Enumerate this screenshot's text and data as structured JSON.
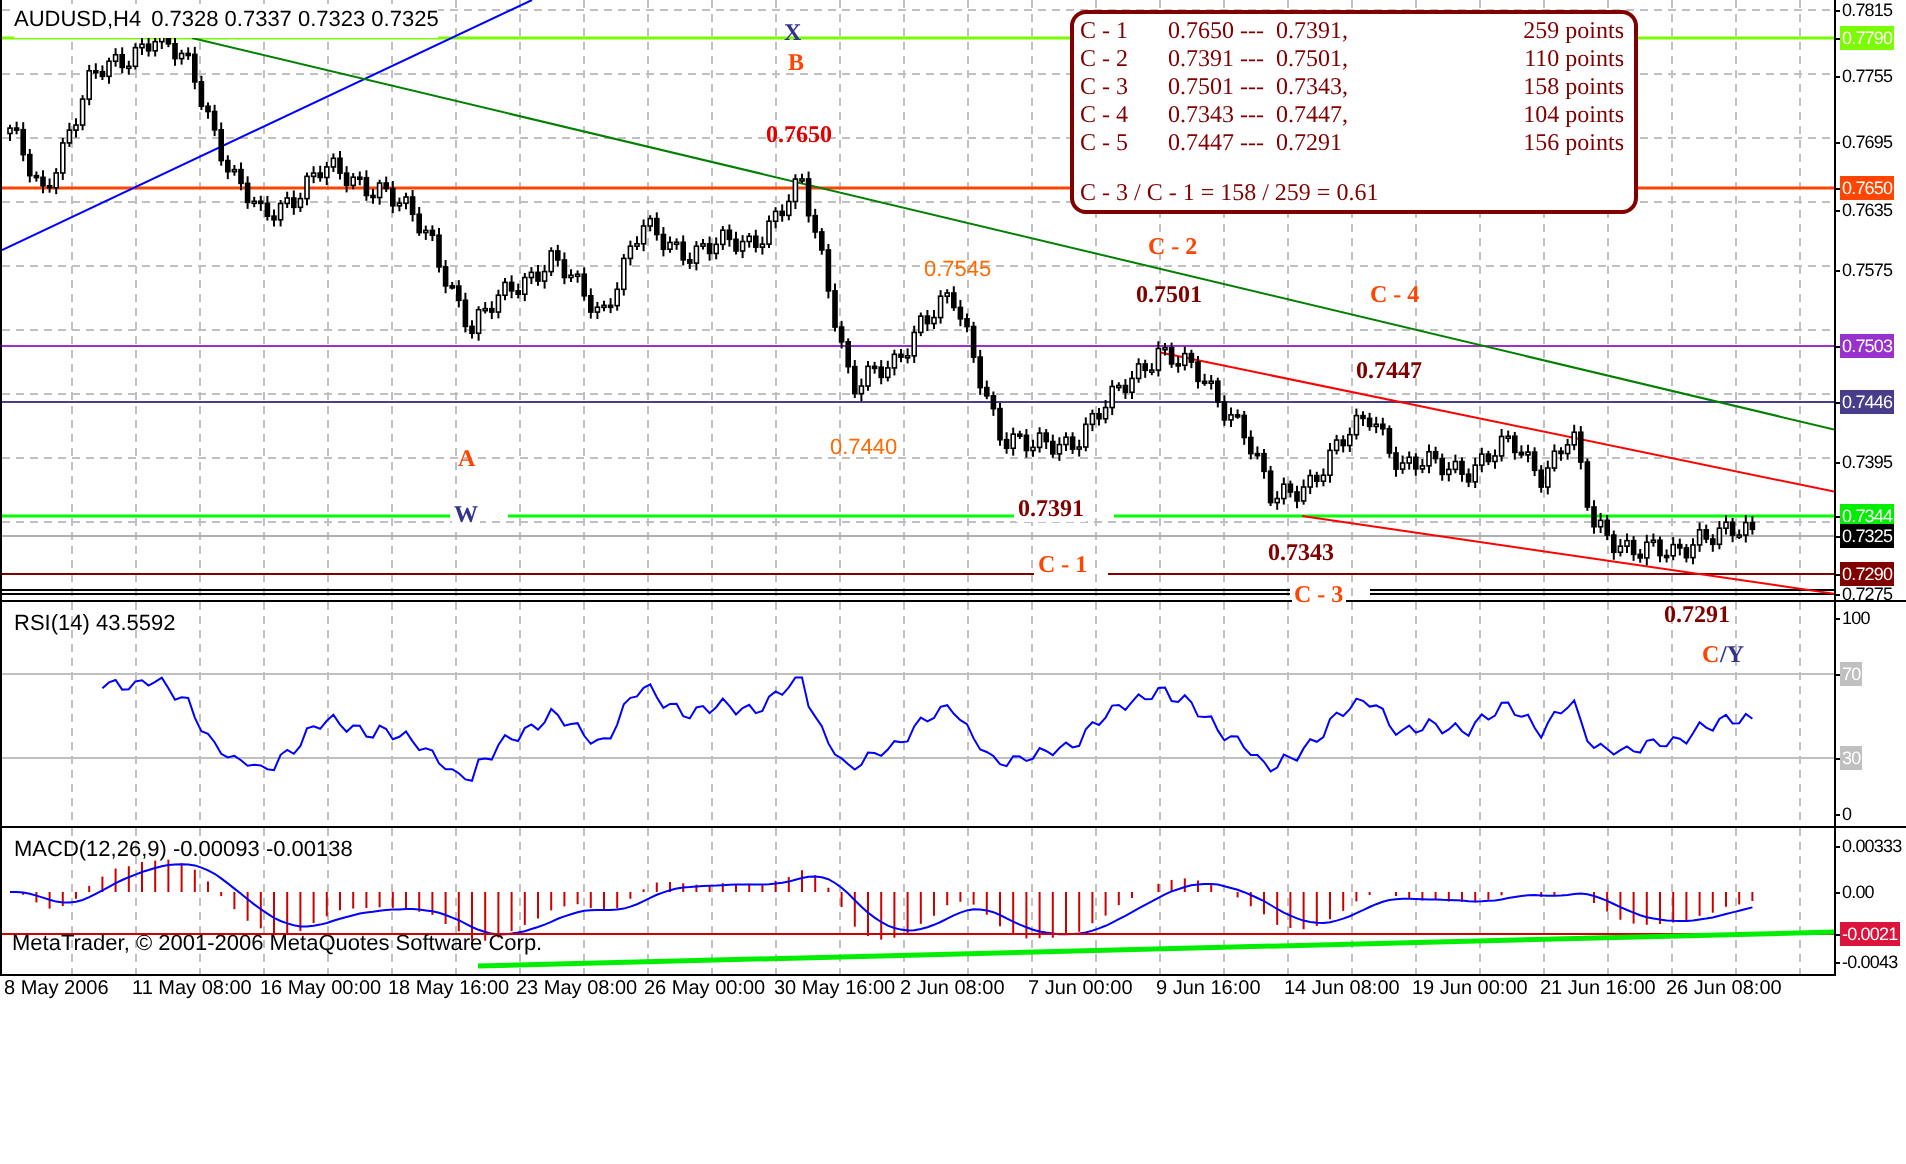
{
  "chart": {
    "symbol": "AUDUSD,H4",
    "ohlc": "0.7328 0.7337 0.7323 0.7325",
    "annotations": [
      {
        "text": "X",
        "kind": "wave",
        "color": "#33338b"
      },
      {
        "text": "B",
        "kind": "wave",
        "color": "#ff4500"
      },
      {
        "text": "0.7650",
        "kind": "wave",
        "color": "#e00000"
      },
      {
        "text": "0.7545",
        "kind": "level",
        "color": "#ff6a00"
      },
      {
        "text": "C - 2",
        "kind": "wave",
        "color": "#ff4500"
      },
      {
        "text": "0.7501",
        "kind": "wave",
        "color": "#800000"
      },
      {
        "text": "C - 4",
        "kind": "wave",
        "color": "#ff4500"
      },
      {
        "text": "0.7447",
        "kind": "wave",
        "color": "#800000"
      },
      {
        "text": "A",
        "kind": "wave",
        "color": "#ff4500"
      },
      {
        "text": "0.7440",
        "kind": "level",
        "color": "#ff6a00"
      },
      {
        "text": "W",
        "kind": "wave",
        "color": "#33338b"
      },
      {
        "text": "0.7391",
        "kind": "wave",
        "color": "#800000"
      },
      {
        "text": "C - 1",
        "kind": "wave",
        "color": "#ff4500"
      },
      {
        "text": "0.7343",
        "kind": "wave",
        "color": "#800000"
      },
      {
        "text": "C - 3",
        "kind": "wave",
        "color": "#ff4500"
      },
      {
        "text": "0.7291",
        "kind": "wave",
        "color": "#800000"
      },
      {
        "text": "C",
        "kind": "wave",
        "color": "#ff4500"
      },
      {
        "text": "/Y",
        "kind": "wave",
        "color": "#33338b"
      }
    ],
    "price_axis": [
      {
        "text": "0.7815",
        "kind": "tick"
      },
      {
        "text": "0.7790",
        "kind": "marker",
        "color": "#7cfc00"
      },
      {
        "text": "0.7755",
        "kind": "tick"
      },
      {
        "text": "0.7695",
        "kind": "tick"
      },
      {
        "text": "0.7650",
        "kind": "marker",
        "color": "#ff4500"
      },
      {
        "text": "0.7635",
        "kind": "tick"
      },
      {
        "text": "0.7575",
        "kind": "tick"
      },
      {
        "text": "0.7503",
        "kind": "marker",
        "color": "#9932cc"
      },
      {
        "text": "0.7446",
        "kind": "marker",
        "color": "#483d8b"
      },
      {
        "text": "0.7395",
        "kind": "tick"
      },
      {
        "text": "0.7344",
        "kind": "marker",
        "color": "#00ee00"
      },
      {
        "text": "0.7325",
        "kind": "marker",
        "color": "#000000"
      },
      {
        "text": "0.7290",
        "kind": "marker",
        "color": "#800000"
      },
      {
        "text": "0.7275",
        "kind": "tick"
      }
    ]
  },
  "info_box": {
    "rows": [
      {
        "label": "C - 1",
        "range": "0.7650 ---  0.7391,",
        "points": "259 points"
      },
      {
        "label": "C - 2",
        "range": "0.7391 ---  0.7501,",
        "points": "110 points"
      },
      {
        "label": "C - 3",
        "range": "0.7501 ---  0.7343,",
        "points": "158 points"
      },
      {
        "label": "C - 4",
        "range": "0.7343 ---  0.7447,",
        "points": "104 points"
      },
      {
        "label": "C - 5",
        "range": "0.7447 ---  0.7291",
        "points": "156 points"
      }
    ],
    "ratio": "C - 3 / C - 1 = 158 / 259 = 0.61"
  },
  "rsi": {
    "title": "RSI(14) 43.5592",
    "axis": [
      {
        "text": "100",
        "kind": "tick"
      },
      {
        "text": "70",
        "kind": "marker",
        "color": "#c0c0c0"
      },
      {
        "text": "30",
        "kind": "marker",
        "color": "#c0c0c0"
      },
      {
        "text": "0",
        "kind": "tick"
      }
    ]
  },
  "macd": {
    "title": "MACD(12,26,9) -0.00093 -0.00138",
    "copyright": "MetaTrader, © 2001-2006 MetaQuotes Software Corp.",
    "axis": [
      {
        "text": "0.00333",
        "kind": "tick"
      },
      {
        "text": "0.00",
        "kind": "tick"
      },
      {
        "text": "-0.0021",
        "kind": "marker",
        "color": "#dc143c"
      },
      {
        "text": "-0.0043",
        "kind": "tick"
      }
    ]
  },
  "time_axis": [
    "8 May 2006",
    "11 May 08:00",
    "16 May 00:00",
    "18 May 16:00",
    "23 May 08:00",
    "26 May 00:00",
    "30 May 16:00",
    "2 Jun 08:00",
    "7 Jun 00:00",
    "9 Jun 16:00",
    "14 Jun 08:00",
    "19 Jun 00:00",
    "21 Jun 16:00",
    "26 Jun 08:00"
  ]
}
